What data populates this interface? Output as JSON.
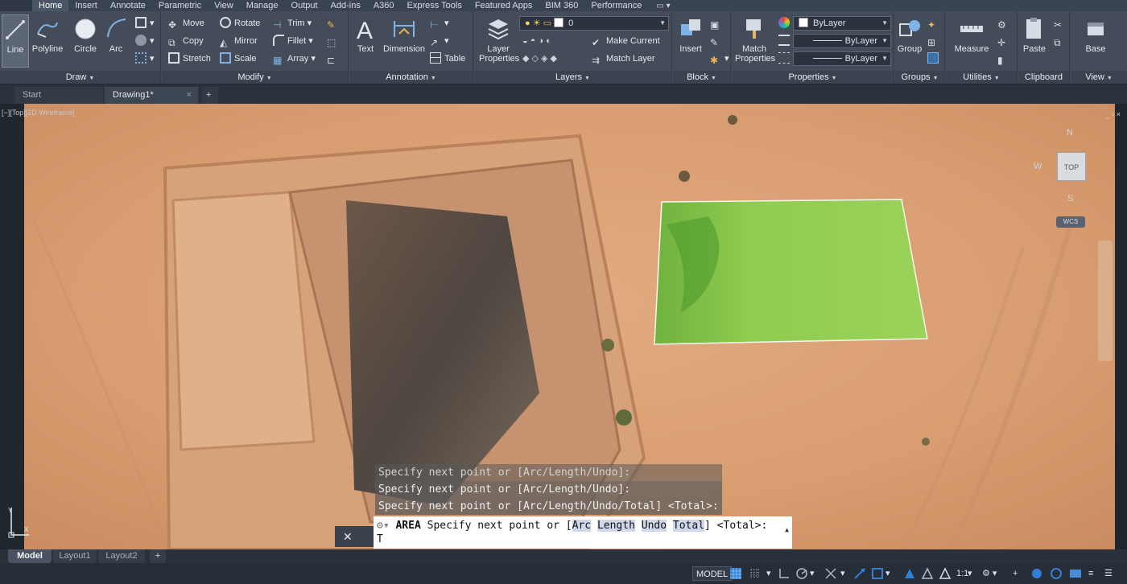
{
  "ribbon_tabs": [
    "Home",
    "Insert",
    "Annotate",
    "Parametric",
    "View",
    "Manage",
    "Output",
    "Add-ins",
    "A360",
    "Express Tools",
    "Featured Apps",
    "BIM 360",
    "Performance"
  ],
  "panels": {
    "draw": {
      "title": "Draw",
      "line": "Line",
      "polyline": "Polyline",
      "circle": "Circle",
      "arc": "Arc"
    },
    "modify": {
      "title": "Modify",
      "move": "Move",
      "rotate": "Rotate",
      "trim": "Trim",
      "copy": "Copy",
      "mirror": "Mirror",
      "fillet": "Fillet",
      "stretch": "Stretch",
      "scale": "Scale",
      "array": "Array"
    },
    "annotation": {
      "title": "Annotation",
      "text": "Text",
      "dimension": "Dimension",
      "table": "Table"
    },
    "layers": {
      "title": "Layers",
      "layer_properties_1": "Layer",
      "layer_properties_2": "Properties",
      "current_layer": "0",
      "make_current": "Make Current",
      "match_layer": "Match Layer"
    },
    "block": {
      "title": "Block",
      "insert": "Insert"
    },
    "properties": {
      "title": "Properties",
      "match_properties_1": "Match",
      "match_properties_2": "Properties",
      "color": "ByLayer",
      "linetype": "ByLayer",
      "lineweight": "ByLayer"
    },
    "groups": {
      "title": "Groups",
      "group": "Group"
    },
    "utilities": {
      "title": "Utilities",
      "measure": "Measure"
    },
    "clipboard": {
      "title": "Clipboard",
      "paste": "Paste"
    },
    "view": {
      "title": "View",
      "base": "Base"
    }
  },
  "file_tabs": {
    "start": "Start",
    "drawing": "Drawing1*",
    "close_glyph": "×",
    "add_glyph": "+"
  },
  "viewport": {
    "label": "[−][Top][2D Wireframe]",
    "controls": "_ ▫ ×"
  },
  "viewcube": {
    "north": "N",
    "west": "W",
    "south": "S",
    "top": "TOP",
    "wcs": "WCS"
  },
  "command": {
    "history": [
      "Specify next point or [Arc/Length/Undo]:",
      "Specify next point or [Arc/Length/Undo]:",
      "Specify next point or [Arc/Length/Undo/Total] <Total>:"
    ],
    "name": "AREA",
    "prompt_prefix": "Specify next point or [",
    "options": [
      "Arc",
      "Length",
      "Undo",
      "Total"
    ],
    "prompt_suffix": "] <Total>:",
    "typed": "T",
    "close_glyph": "✕"
  },
  "layout_tabs": [
    "Model",
    "Layout1",
    "Layout2"
  ],
  "status": {
    "model": "MODEL",
    "scale": "1:1"
  },
  "colors": {
    "ribbon_bg": "#444c59",
    "cmd_bg": "#ffffff",
    "polygon_fill": "#8ccc4e",
    "accent_blue": "#2f7fd6"
  }
}
